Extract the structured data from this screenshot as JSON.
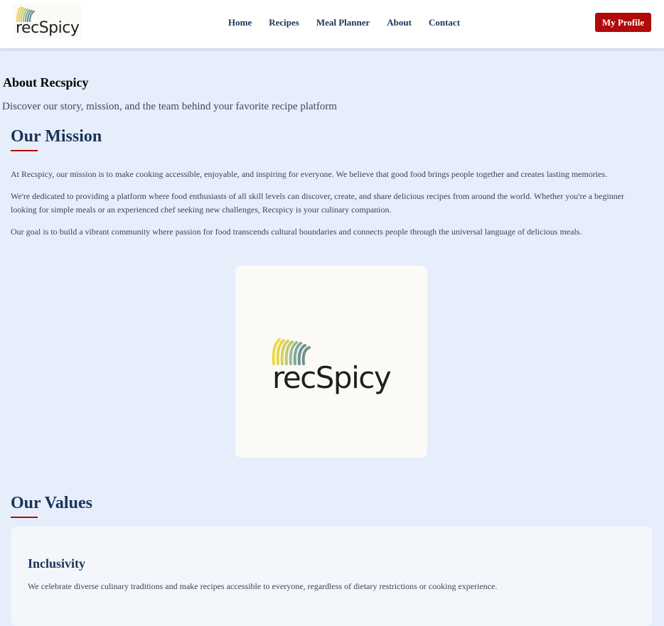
{
  "header": {
    "logo_text": "recSpicy",
    "nav": [
      "Home",
      "Recipes",
      "Meal Planner",
      "About",
      "Contact"
    ],
    "profile_button": "My Profile"
  },
  "page": {
    "title": "About Recspicy",
    "subtitle": "Discover our story, mission, and the team behind your favorite recipe platform"
  },
  "mission": {
    "heading": "Our Mission",
    "paragraphs": [
      "At Recspicy, our mission is to make cooking accessible, enjoyable, and inspiring for everyone. We believe that good food brings people together and creates lasting memories.",
      "We're dedicated to providing a platform where food enthusiasts of all skill levels can discover, create, and share delicious recipes from around the world. Whether you're a beginner looking for simple meals or an experienced chef seeking new challenges, Recspicy is your culinary companion.",
      "Our goal is to build a vibrant community where passion for food transcends cultural boundaries and connects people through the universal language of delicious meals."
    ],
    "image_logo_text": "recSpicy"
  },
  "values": {
    "heading": "Our Values",
    "items": [
      {
        "title": "Inclusivity",
        "text": "We celebrate diverse culinary traditions and make recipes accessible to everyone, regardless of dietary restrictions or cooking experience."
      }
    ]
  },
  "colors": {
    "brand_navy": "#1b3358",
    "brand_red": "#b00a0a",
    "page_background": "#e6eefb"
  }
}
